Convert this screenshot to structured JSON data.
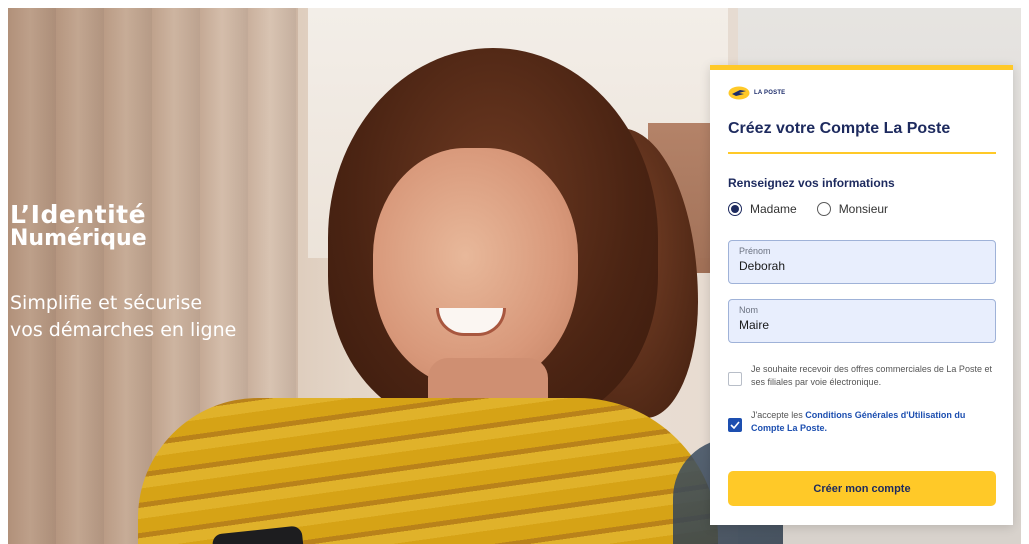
{
  "hero": {
    "title_line1": "L’Identité",
    "title_line2": "Numérique",
    "subtitle_line1": "Simplifie et sécurise",
    "subtitle_line2": "vos démarches en ligne"
  },
  "form": {
    "brand": "LA POSTE",
    "title": "Créez votre Compte La Poste",
    "section_title": "Renseignez vos informations",
    "civility": {
      "options": [
        "Madame",
        "Monsieur"
      ],
      "selected": "Madame"
    },
    "first_name": {
      "label": "Prénom",
      "value": "Deborah"
    },
    "last_name": {
      "label": "Nom",
      "value": "Maire"
    },
    "offers_consent": {
      "text": "Je souhaite recevoir des offres commerciales de La Poste et ses filiales par voie électronique.",
      "checked": false
    },
    "cgu_consent": {
      "text_prefix": "J'accepte les ",
      "link_text": "Conditions Générales d'Utilisation du Compte La Poste.",
      "checked": true
    },
    "submit_label": "Créer mon compte"
  },
  "colors": {
    "brand_yellow": "#ffc928",
    "brand_navy": "#1d2a5e",
    "link_blue": "#1d4fb0",
    "field_bg": "#e8eefd"
  }
}
